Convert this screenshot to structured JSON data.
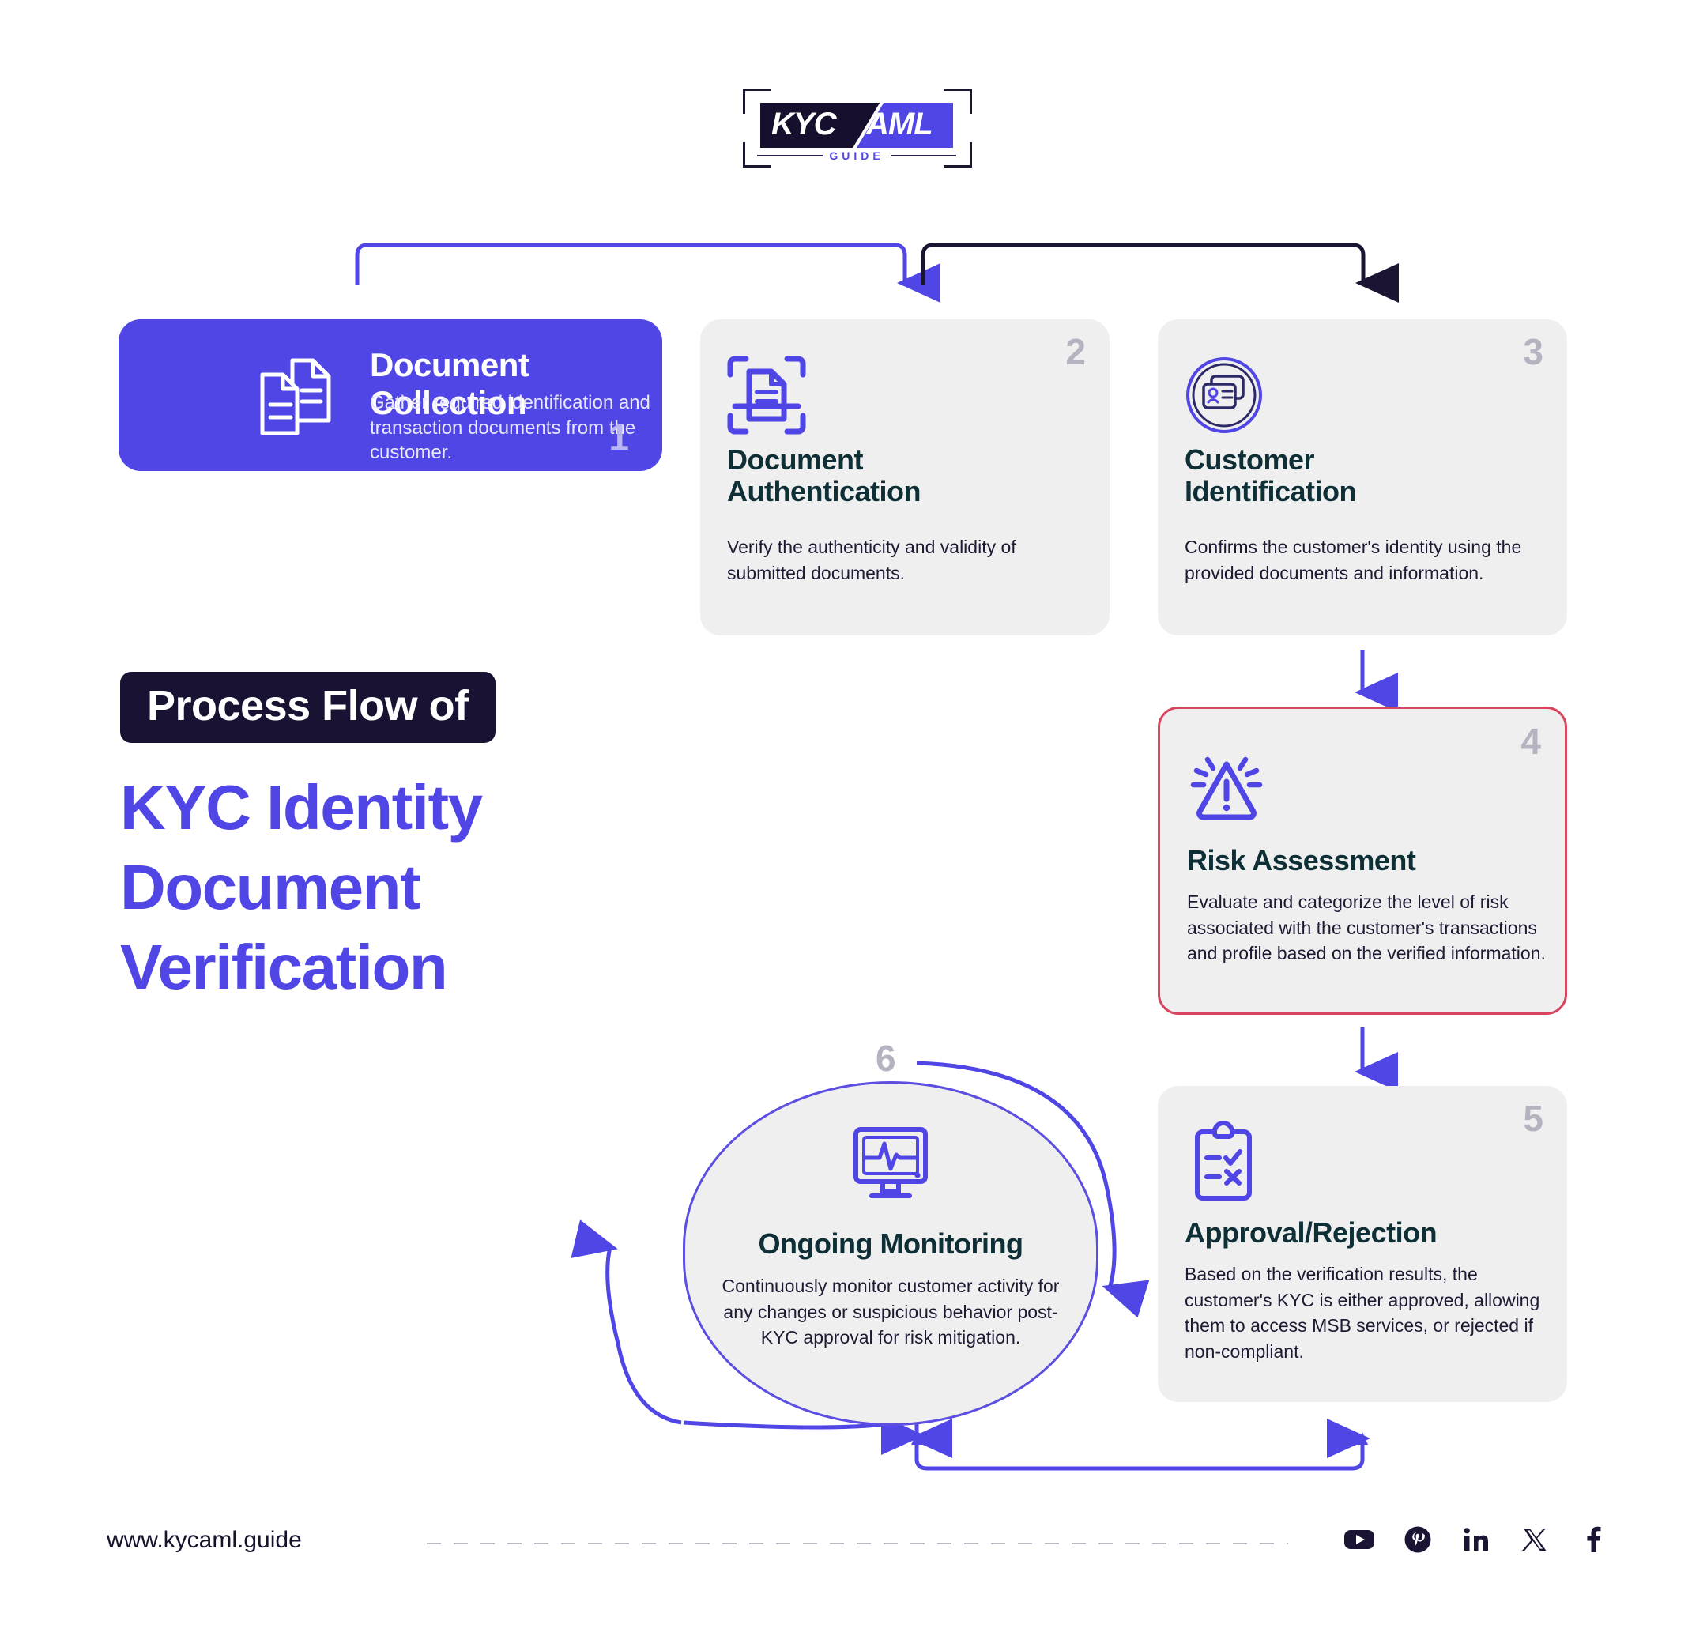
{
  "logo": {
    "kyc": "KYC",
    "aml": "AML",
    "guide": "GUIDE"
  },
  "heading": {
    "eyebrow": "Process Flow of",
    "title": "KYC Identity Document Verification"
  },
  "steps": [
    {
      "number": "1",
      "title": "Document Collection",
      "description": "Gather required identification and transaction documents from the customer.",
      "icon": "documents-icon",
      "highlight": true
    },
    {
      "number": "2",
      "title": "Document Authentication",
      "description": "Verify the authenticity and validity of submitted documents.",
      "icon": "document-scan-icon",
      "highlight": false
    },
    {
      "number": "3",
      "title": "Customer Identification",
      "description": "Confirms the customer's identity using the provided documents and information.",
      "icon": "id-card-circle-icon",
      "highlight": false
    },
    {
      "number": "4",
      "title": "Risk Assessment",
      "description": "Evaluate and categorize the level of risk associated with the customer's transactions and profile based on the verified information.",
      "icon": "warning-triangle-icon",
      "highlight": false,
      "alert": true
    },
    {
      "number": "5",
      "title": "Approval/Rejection",
      "description": "Based on the verification results, the customer's KYC is either approved, allowing them to access MSB services, or rejected if non-compliant.",
      "icon": "clipboard-check-x-icon",
      "highlight": false
    },
    {
      "number": "6",
      "title": "Ongoing Monitoring",
      "description": "Continuously monitor customer activity for any changes or suspicious behavior post-KYC approval for risk mitigation.",
      "icon": "monitor-pulse-icon",
      "highlight": false
    }
  ],
  "footer": {
    "url": "www.kycaml.guide",
    "socials": [
      "youtube-icon",
      "pinterest-icon",
      "linkedin-icon",
      "x-twitter-icon",
      "facebook-icon"
    ]
  },
  "colors": {
    "accent": "#4f46e5",
    "dark": "#16102e",
    "card_bg": "#efeff0",
    "title_text": "#0d2f35",
    "number_gray": "#b4b3bf",
    "alert_border": "#d9445f",
    "connector_dark": "#1b1433"
  }
}
